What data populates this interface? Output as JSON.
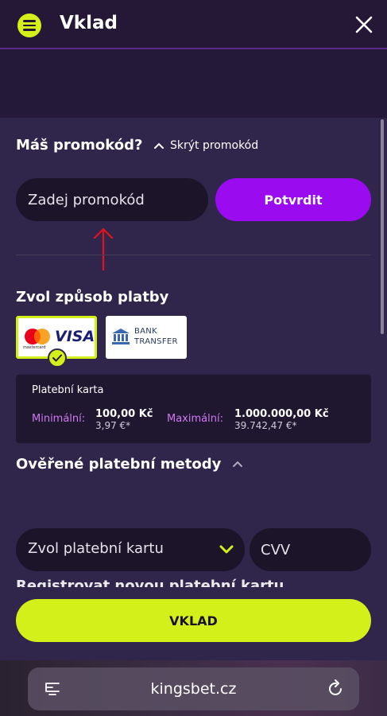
{
  "header": {
    "title": "Vklad",
    "menu_icon": "hamburger-menu-icon",
    "close_icon": "close-icon"
  },
  "promo": {
    "question": "Máš promokód?",
    "hide_label": "Skrýt promokód",
    "input_placeholder": "Zadej promokód",
    "confirm_label": "Potvrdit"
  },
  "payment": {
    "title": "Zvol způsob platby",
    "methods": [
      {
        "name": "Mastercard / Visa",
        "mastercard_label": "mastercard",
        "visa_label": "VISA",
        "selected": true
      },
      {
        "name": "Bank Transfer",
        "line1": "BANK",
        "line2": "TRANSFER",
        "selected": false
      }
    ],
    "info": {
      "title": "Platební karta",
      "min_label": "Minimální:",
      "min_value": "100,00 Kč",
      "min_sub": "3,97 €*",
      "max_label": "Maximální:",
      "max_value": "1.000.000,00 Kč",
      "max_sub": "39.742,47 €*"
    }
  },
  "verified": {
    "title": "Ověřené platební metody",
    "select_card_label": "Zvol platební kartu",
    "cvv_placeholder": "CVV",
    "partial_text": "Registrovat novou platební kartu"
  },
  "deposit_button_label": "VKLAD",
  "browser": {
    "url": "kingsbet.cz",
    "tabs_icon": "tabs-icon",
    "reload_icon": "reload-icon"
  },
  "colors": {
    "accent_lime": "#d4f01a",
    "accent_purple": "#9a0bf0",
    "background": "#241836",
    "panel": "#30254a",
    "annotation_red": "#e0141e"
  }
}
